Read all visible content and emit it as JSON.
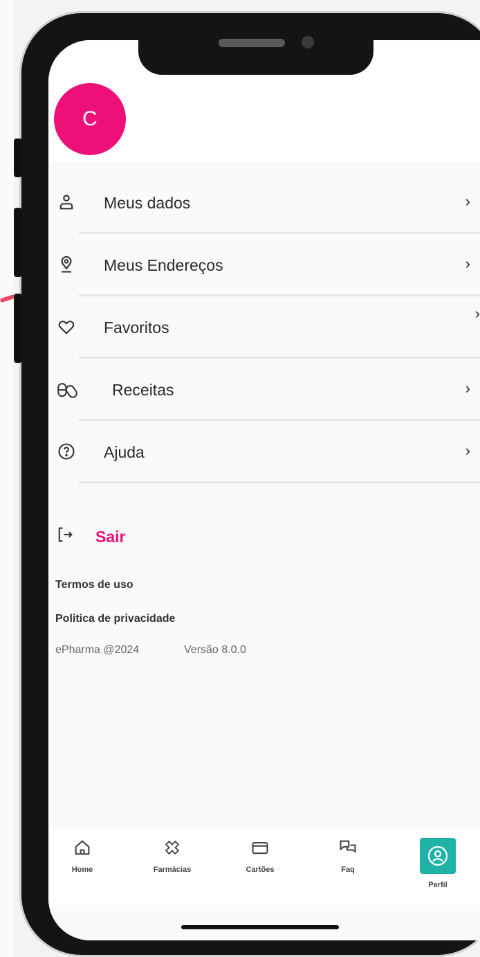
{
  "profile": {
    "avatar_initial": "C"
  },
  "menu": {
    "items": [
      {
        "label": "Meus dados",
        "icon": "person-icon"
      },
      {
        "label": "Meus Endereços",
        "icon": "location-pin-icon"
      },
      {
        "label": "Favoritos",
        "icon": "heart-icon"
      },
      {
        "label": "Receitas",
        "icon": "pills-icon"
      },
      {
        "label": "Ajuda",
        "icon": "help-circle-icon"
      }
    ],
    "chevron": "›"
  },
  "logout": {
    "label": "Sair",
    "icon": "logout-icon"
  },
  "footer": {
    "terms": "Termos de uso",
    "privacy": "Politica de privacidade",
    "copyright": "ePharma @2024",
    "version": "Versão 8.0.0"
  },
  "tabbar": {
    "tabs": [
      {
        "label": "Home",
        "icon": "home-icon"
      },
      {
        "label": "Farmácias",
        "icon": "pharmacy-cross-icon"
      },
      {
        "label": "Cartões",
        "icon": "card-icon"
      },
      {
        "label": "Faq",
        "icon": "chat-bubbles-icon"
      },
      {
        "label": "Perfil",
        "icon": "profile-icon"
      }
    ],
    "active": "Perfil"
  },
  "colors": {
    "brand": "#ee0f78",
    "active_tab": "#1fb3a7"
  }
}
